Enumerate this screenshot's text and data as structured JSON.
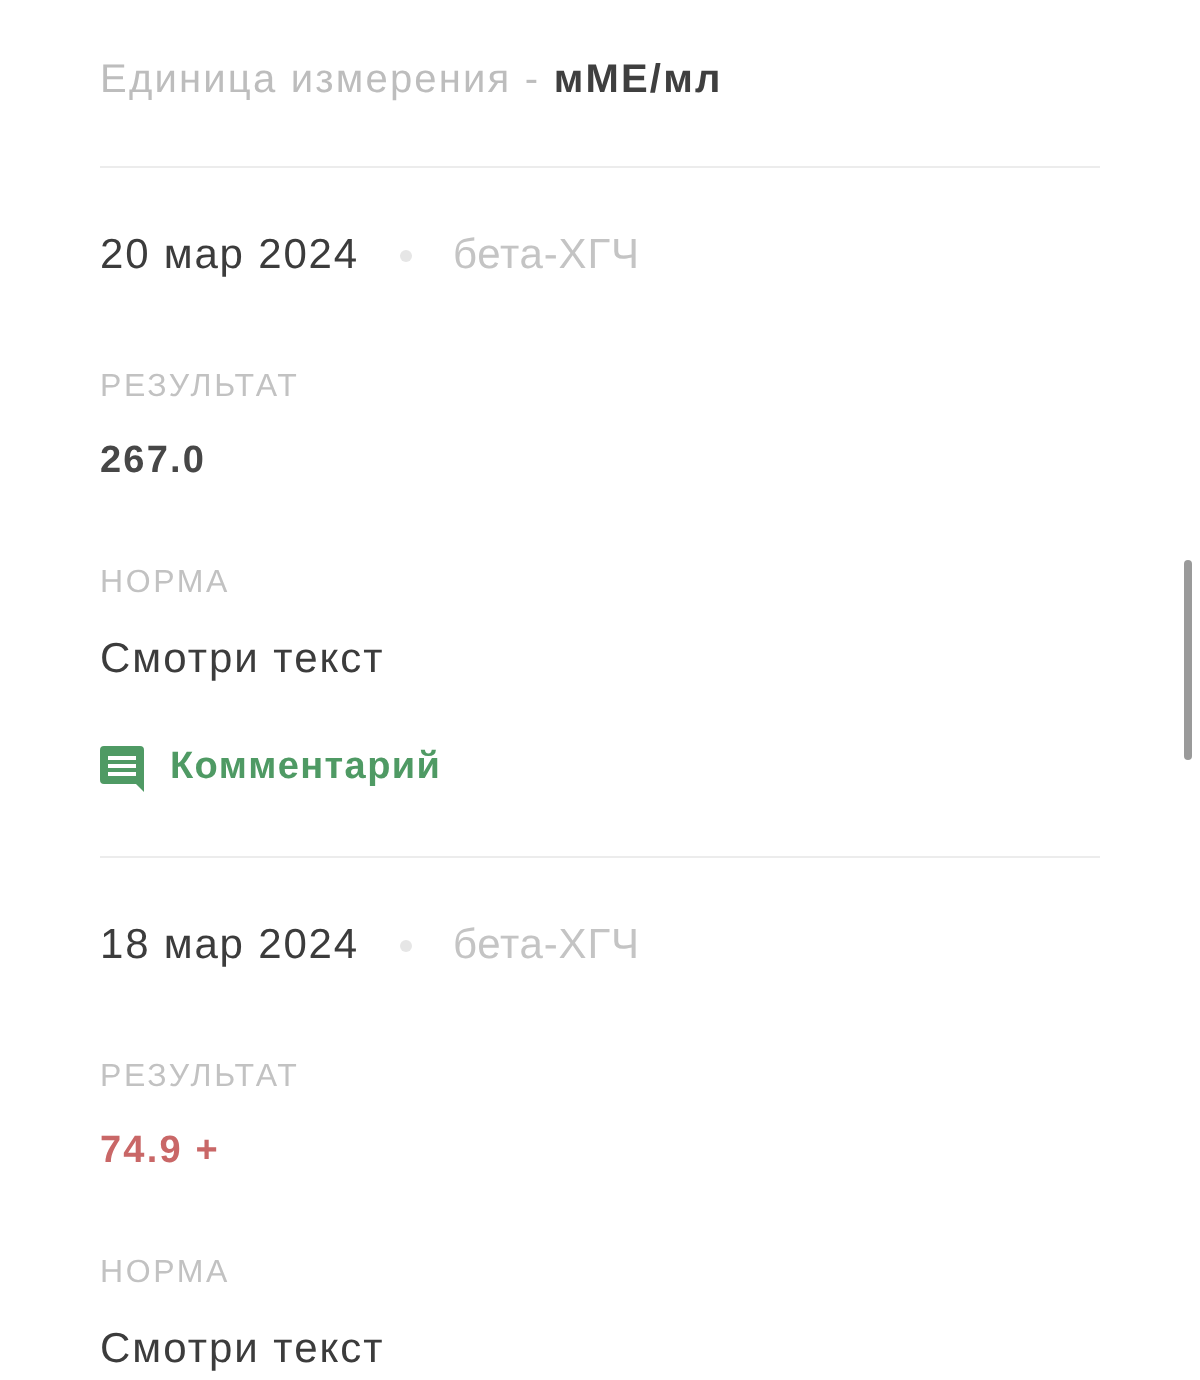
{
  "unit_note": "Единица измерения - **мМЕ/мл**",
  "results": [
    {
      "date": "20 мар 2024",
      "test": "бета-ХГЧ",
      "result_label": "РЕЗУЛЬТАТ",
      "result": "267.0",
      "out_of_range": false,
      "norm_label": "НОРМА",
      "norm": "Смотри текст",
      "comment_link": "Комментарий"
    },
    {
      "date": "18 мар 2024",
      "test": "бета-ХГЧ",
      "result_label": "РЕЗУЛЬТАТ",
      "result": "74.9 +",
      "out_of_range": true,
      "norm_label": "НОРМА",
      "norm": "Смотри текст"
    }
  ]
}
